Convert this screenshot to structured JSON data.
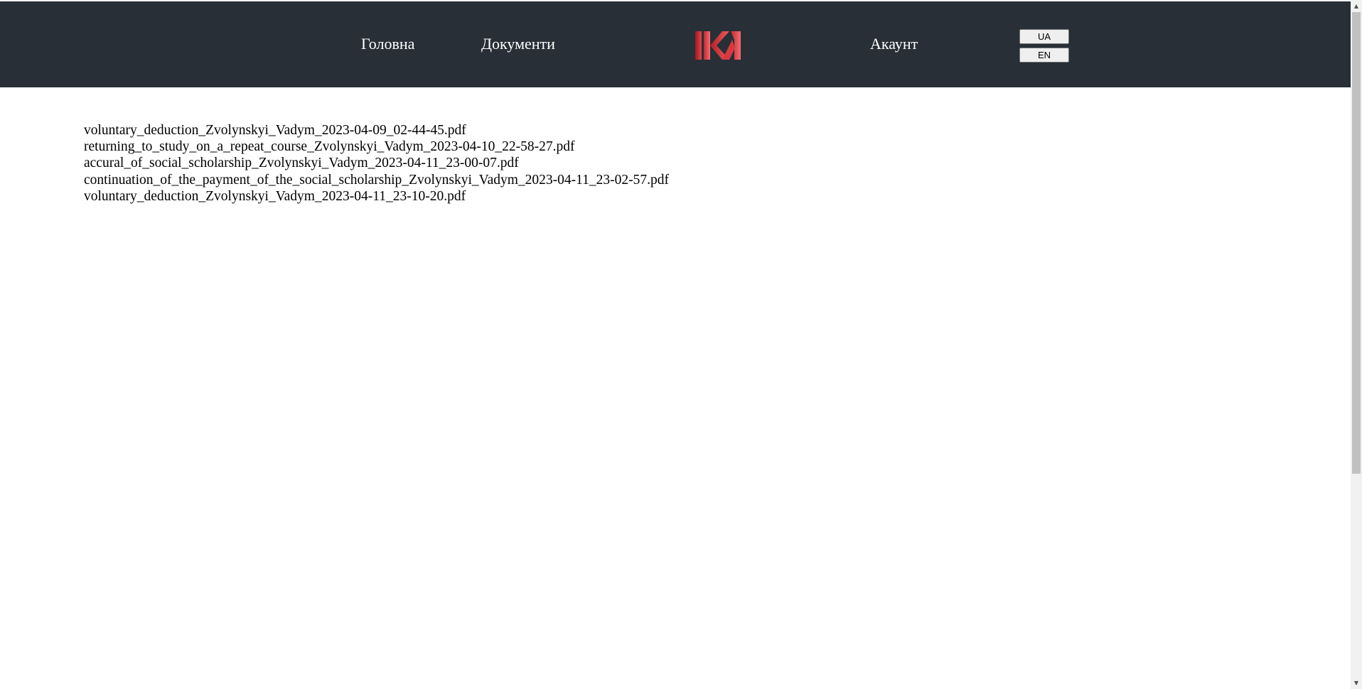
{
  "header": {
    "nav": {
      "home": "Головна",
      "documents": "Документи",
      "account": "Акаунт"
    },
    "logo_icon": "ikm-logo",
    "languages": [
      "UA",
      "EN"
    ],
    "background_color": "#282f36"
  },
  "documents": {
    "files": [
      "voluntary_deduction_Zvolynskyi_Vadym_2023-04-09_02-44-45.pdf",
      "returning_to_study_on_a_repeat_course_Zvolynskyi_Vadym_2023-04-10_22-58-27.pdf",
      "accural_of_social_scholarship_Zvolynskyi_Vadym_2023-04-11_23-00-07.pdf",
      "continuation_of_the_payment_of_the_social_scholarship_Zvolynskyi_Vadym_2023-04-11_23-02-57.pdf",
      "voluntary_deduction_Zvolynskyi_Vadym_2023-04-11_23-10-20.pdf"
    ]
  },
  "scrollbar": {
    "up_icon": "scroll-up-arrow-icon",
    "down_icon": "scroll-down-arrow-icon"
  }
}
